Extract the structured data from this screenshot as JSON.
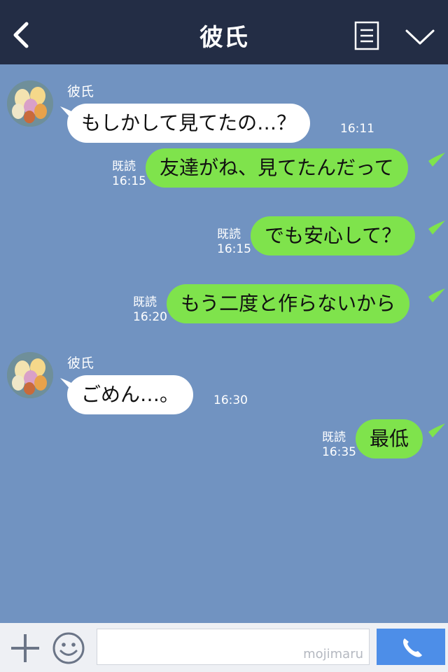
{
  "header": {
    "title": "彼氏"
  },
  "messages": [
    {
      "sender": "彼氏",
      "text": "もしかして見てたの…？",
      "time": "16:11"
    },
    {
      "text": "友達がね、見てたんだって",
      "read_label": "既読",
      "time": "16:15"
    },
    {
      "text": "でも安心して？",
      "read_label": "既読",
      "time": "16:15"
    },
    {
      "text": "もう二度と作らないから",
      "read_label": "既読",
      "time": "16:20"
    },
    {
      "sender": "彼氏",
      "text": "ごめん…。",
      "time": "16:30"
    },
    {
      "text": "最低",
      "read_label": "既読",
      "time": "16:35"
    }
  ],
  "input": {
    "watermark": "mojimaru"
  },
  "colors": {
    "header": "#232d45",
    "chat_bg": "#7193c1",
    "bubble_out": "#7fe34c",
    "bubble_in": "#ffffff",
    "call_button": "#4d8ee8"
  },
  "icons": [
    "back-icon",
    "menu-list-icon",
    "chevron-down-icon",
    "plus-icon",
    "emoji-icon",
    "phone-icon"
  ]
}
